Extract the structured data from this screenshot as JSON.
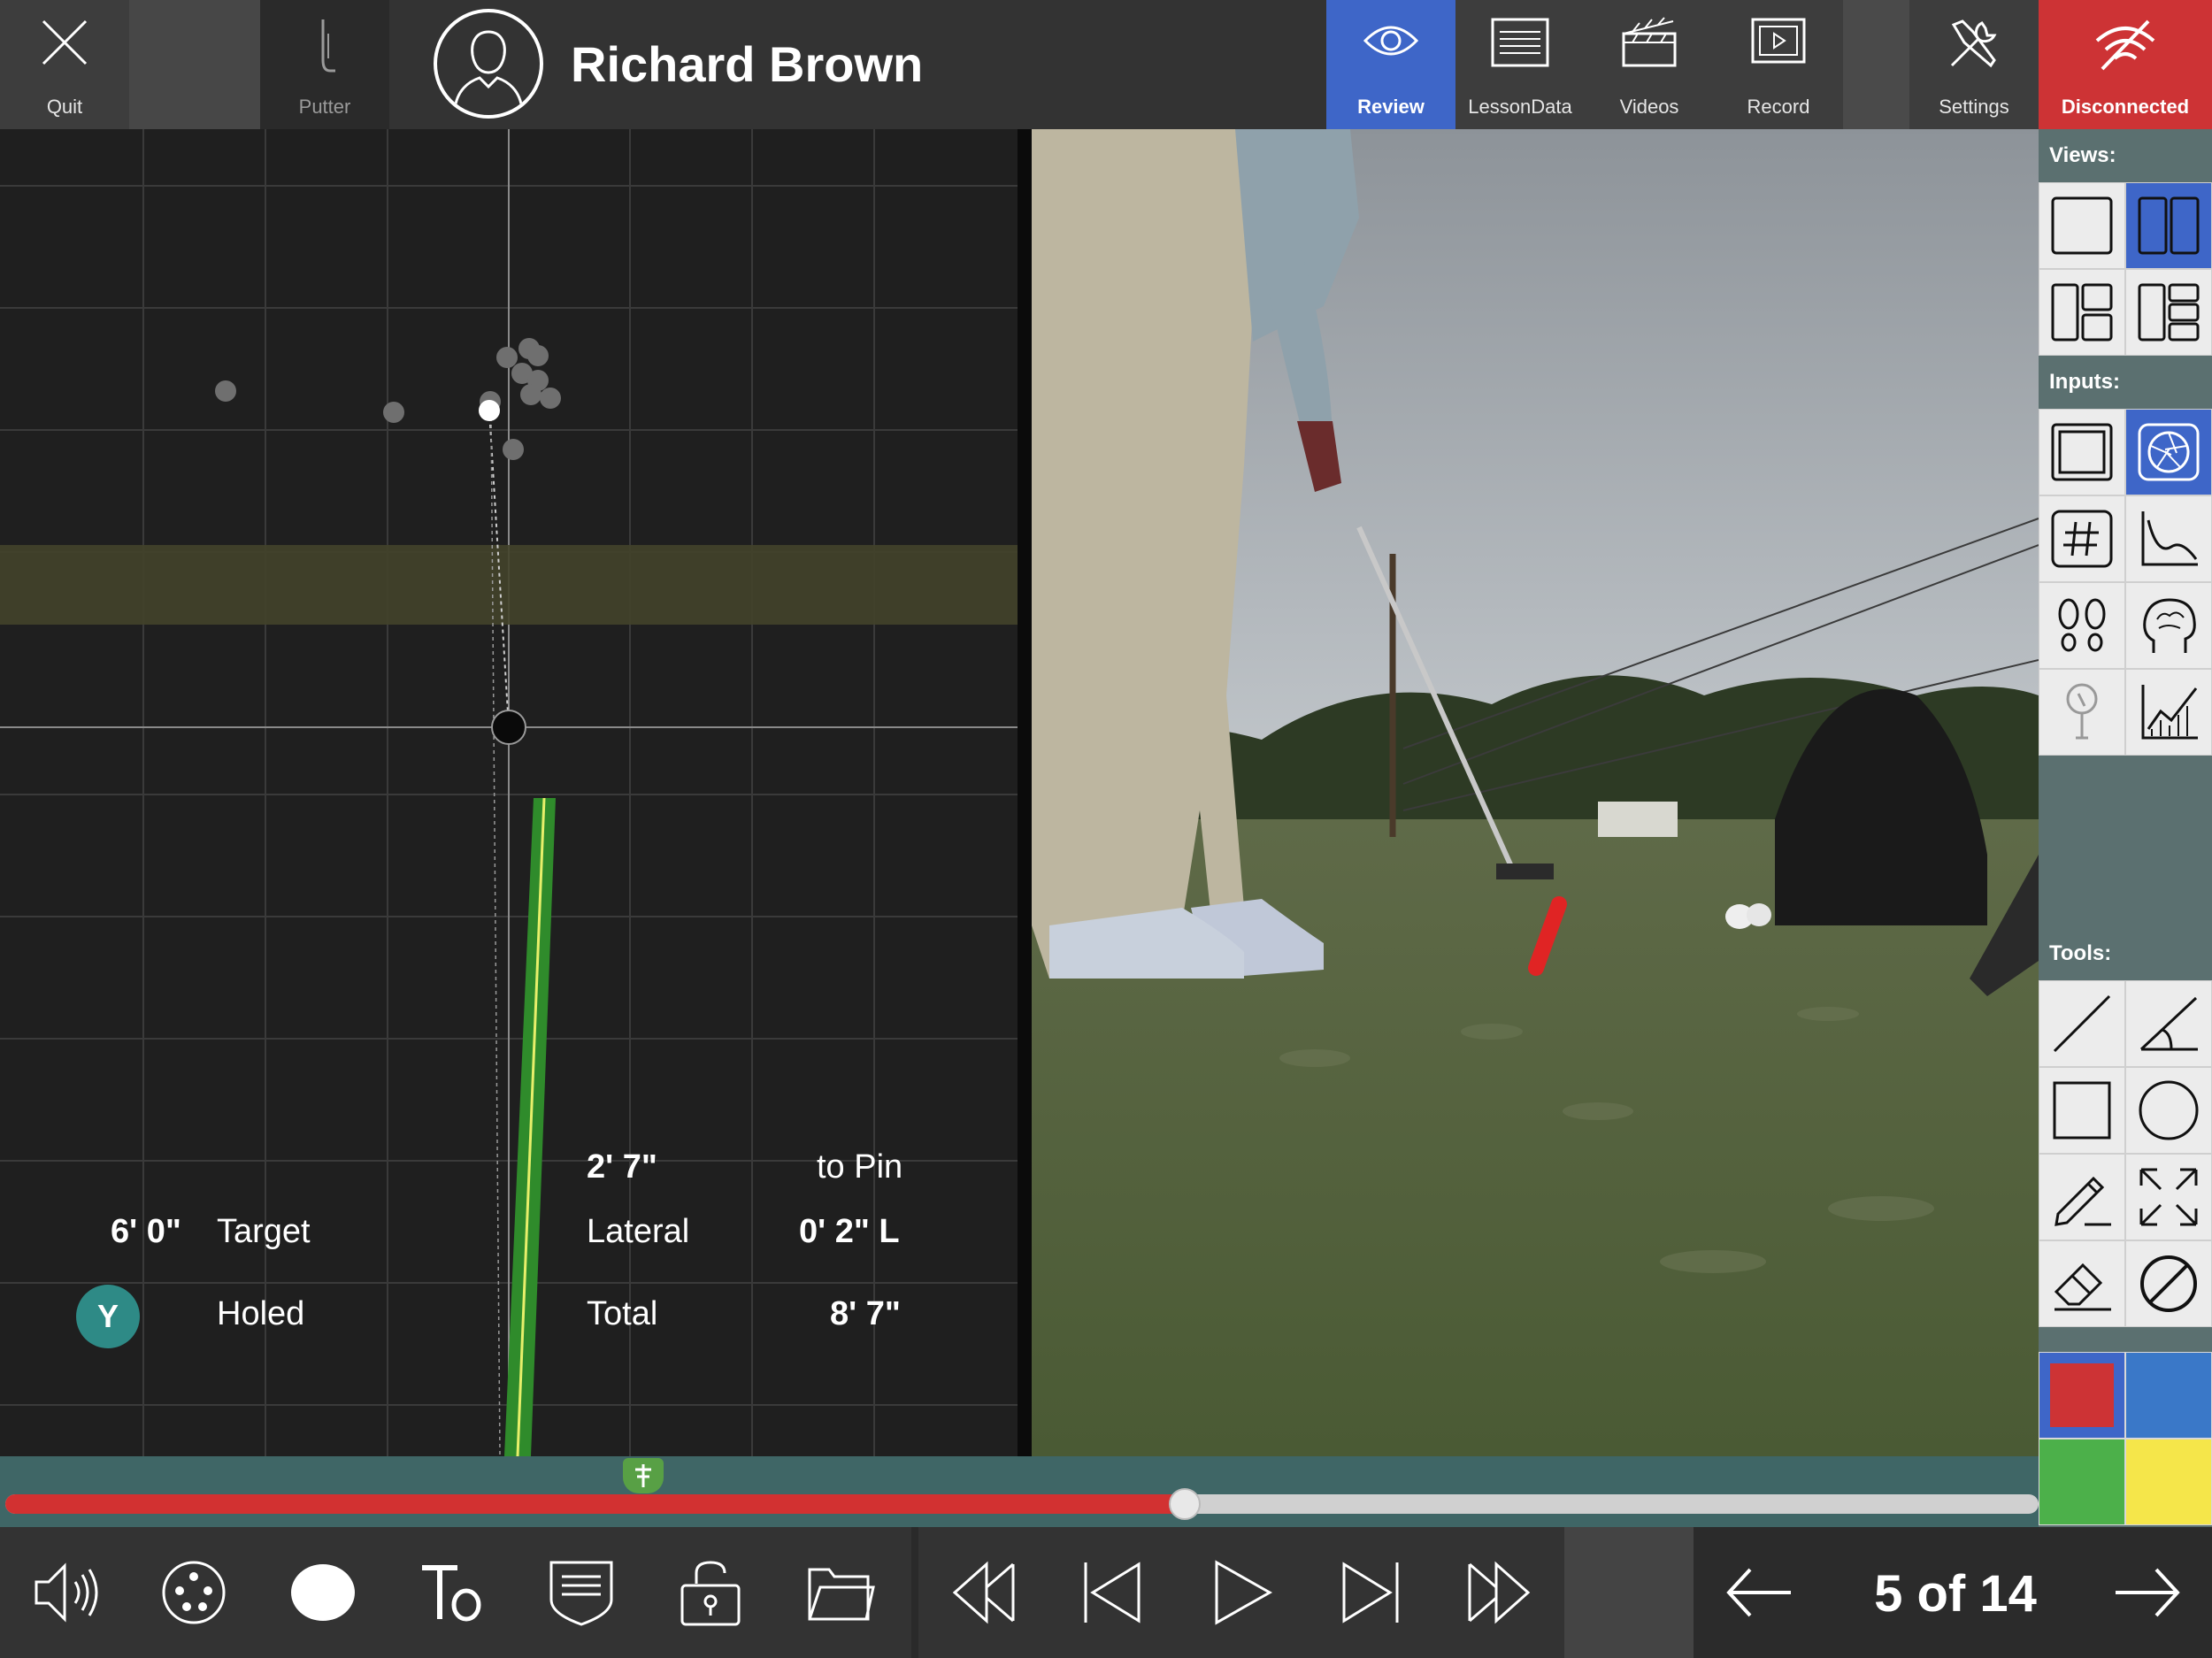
{
  "topbar": {
    "quit_label": "Quit",
    "putter_label": "Putter",
    "student_name": "Richard Brown",
    "review_label": "Review",
    "lessondata_label": "LessonData",
    "videos_label": "Videos",
    "record_label": "Record",
    "settings_label": "Settings",
    "disconnected_label": "Disconnected"
  },
  "stats": {
    "target_value": "6' 0\"",
    "target_label": "Target",
    "holed_badge": "Y",
    "holed_label": "Holed",
    "to_pin_value": "2' 7\"",
    "to_pin_label": "to Pin",
    "lateral_label": "Lateral",
    "lateral_value": "0' 2\" L",
    "total_label": "Total",
    "total_value": "8' 7\""
  },
  "sidebar": {
    "views_title": "Views:",
    "inputs_title": "Inputs:",
    "tools_title": "Tools:",
    "colors": [
      "#cd3335",
      "#3a78c8",
      "#4cb04a",
      "#f5e64a"
    ]
  },
  "bottom": {
    "page_counter": "5 of 14"
  },
  "colors": {
    "accent_blue": "#3e66c8",
    "disconnected_red": "#cd3335",
    "timeline_red": "#d23131"
  },
  "timeline": {
    "progress_fraction": 0.58
  }
}
